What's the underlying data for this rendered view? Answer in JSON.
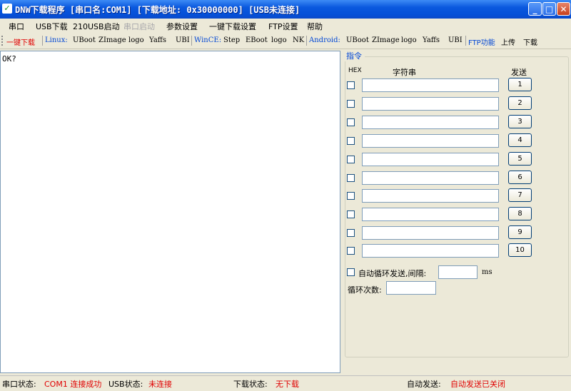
{
  "window": {
    "title": "DNW下载程序 [串口名:COM1] [下载地址: 0x30000000] [USB未连接]"
  },
  "menu": [
    "串口",
    "USB下载",
    "210USB启动",
    "串口启动",
    "参数设置",
    "一键下载设置",
    "FTP设置",
    "帮助"
  ],
  "toolbar": {
    "oneclick": "一键下载",
    "linux_label": "Linux:",
    "linux_items": [
      "UBoot",
      "ZImage",
      "logo",
      "Yaffs",
      "UBI"
    ],
    "wince_label": "WinCE:",
    "wince_items": [
      "Step",
      "EBoot",
      "logo",
      "NK"
    ],
    "android_label": "Android:",
    "android_items": [
      "UBoot",
      "ZImage",
      "logo",
      "Yaffs",
      "UBI"
    ],
    "ftp_label": "FTP功能",
    "ftp_items": [
      "上传",
      "下载"
    ]
  },
  "output": {
    "text": "OK?"
  },
  "commands": {
    "group_title": "指令",
    "hex_header": "HEX",
    "string_header": "字符串",
    "send_header": "发送",
    "rows": [
      "1",
      "2",
      "3",
      "4",
      "5",
      "6",
      "7",
      "8",
      "9",
      "10"
    ],
    "auto_loop_label": "自动循环发送,间隔:",
    "interval_unit": "ms",
    "loop_count_label": "循环次数:"
  },
  "status": {
    "serial_label": "串口状态:",
    "serial_value": "COM1 连接成功",
    "usb_label": "USB状态:",
    "usb_value": "未连接",
    "download_label": "下载状态:",
    "download_value": "无下载",
    "auto_label": "自动发送:",
    "auto_value": "自动发送已关闭"
  }
}
